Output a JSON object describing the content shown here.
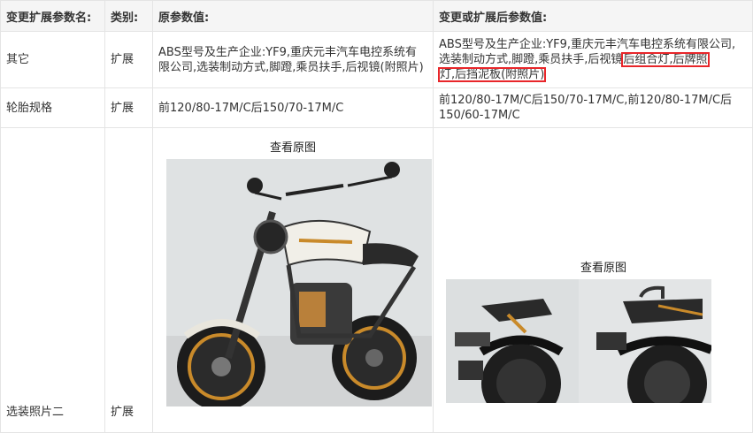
{
  "headers": [
    "变更扩展参数名:",
    "类别:",
    "原参数值:",
    "变更或扩展后参数值:"
  ],
  "rows": [
    {
      "name": "其它",
      "category": "扩展",
      "original": "ABS型号及生产企业:YF9,重庆元丰汽车电控系统有限公司,选装制动方式,脚蹬,乘员扶手,后视镜(附照片)",
      "changed_prefix": "ABS型号及生产企业:YF9,重庆元丰汽车电控系统有限公司,选装制动方式,脚蹬,乘员扶手,后视镜",
      "changed_hl1": "后组合灯,后牌照",
      "changed_hl2a": "灯,后挡泥板",
      "changed_hl2b": "(附照片)"
    },
    {
      "name": "轮胎规格",
      "category": "扩展",
      "original": "前120/80-17M/C后150/70-17M/C",
      "changed": "前120/80-17M/C后150/70-17M/C,前120/80-17M/C后150/60-17M/C"
    },
    {
      "name": "选装照片二",
      "category": "扩展",
      "original_link": "查看原图",
      "changed_link": "查看原图"
    }
  ],
  "colors": {
    "highlight": "#e8262a",
    "header_bg": "#f5f5f5",
    "border": "#e4e4e4"
  }
}
